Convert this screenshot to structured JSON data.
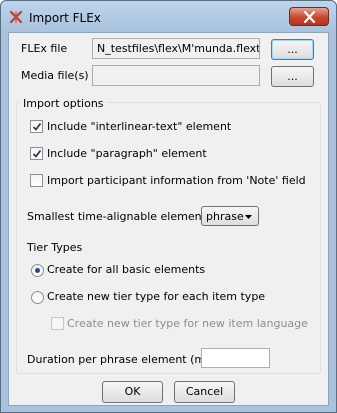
{
  "window": {
    "title": "Import FLEx",
    "app_icon": "elan-icon",
    "close_icon": "close-icon"
  },
  "flex_file": {
    "label": "FLEx file",
    "value": "N_testfiles\\flex\\M'munda.flextext",
    "browse_label": "..."
  },
  "media_files": {
    "label": "Media file(s)",
    "value": "",
    "browse_label": "..."
  },
  "import_options": {
    "title": "Import options",
    "include_interlinear": {
      "label": "Include \"interlinear-text\" element",
      "checked": true
    },
    "include_paragraph": {
      "label": "Include \"paragraph\" element",
      "checked": true
    },
    "import_participant": {
      "label": "Import participant information from 'Note' field",
      "checked": false
    },
    "smallest_element": {
      "label": "Smallest time-alignable element",
      "selected": "phrase"
    },
    "tier_types": {
      "label": "Tier Types",
      "create_basic": {
        "label": "Create for all basic elements",
        "selected": true
      },
      "create_new_per_item": {
        "label": "Create new tier type for each item type",
        "selected": false
      },
      "create_new_per_language": {
        "label": "Create new tier type for new item language",
        "checked": false,
        "enabled": false
      }
    },
    "duration": {
      "label": "Duration per phrase element (ms)",
      "value": ""
    }
  },
  "buttons": {
    "ok": "OK",
    "cancel": "Cancel"
  },
  "colors": {
    "window_frame": "#a9c3de",
    "client_bg": "#f0f0f0",
    "close_button": "#c7482f"
  }
}
